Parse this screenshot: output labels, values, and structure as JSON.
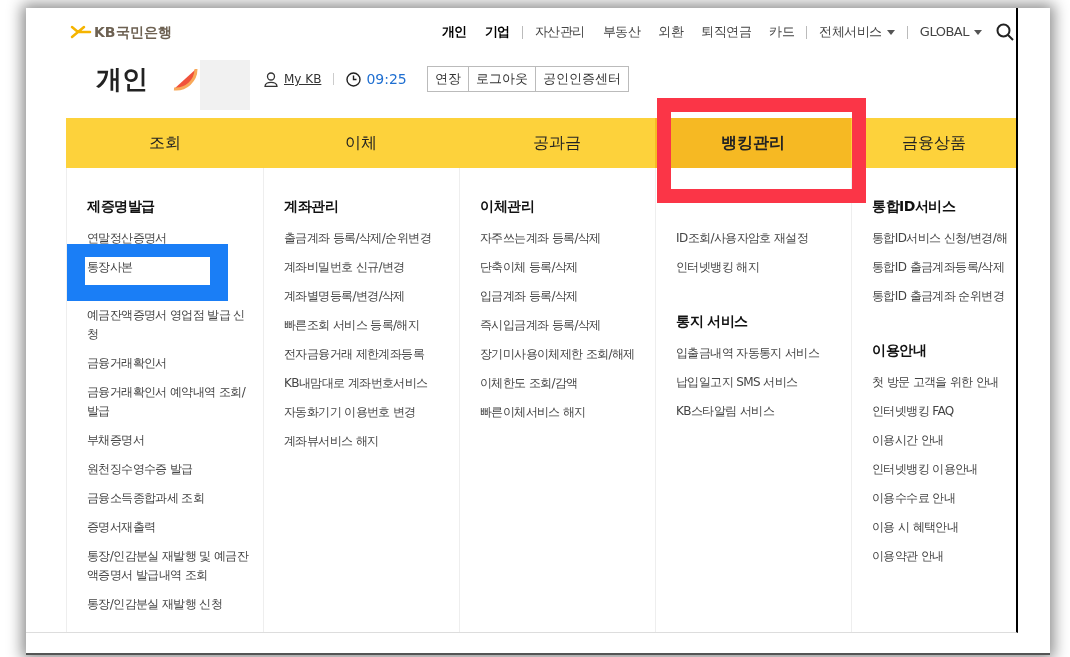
{
  "logo": {
    "text": "KB국민은행"
  },
  "top_nav": [
    {
      "items": [
        {
          "label": "개인",
          "bold": true,
          "has_menu": false
        },
        {
          "label": "기업",
          "bold": true,
          "has_menu": false
        }
      ]
    },
    {
      "items": [
        {
          "label": "자산관리",
          "bold": false,
          "has_menu": false
        },
        {
          "label": "부동산",
          "bold": false,
          "has_menu": false
        },
        {
          "label": "외환",
          "bold": false,
          "has_menu": false
        },
        {
          "label": "퇴직연금",
          "bold": false,
          "has_menu": false
        },
        {
          "label": "카드",
          "bold": false,
          "has_menu": false
        }
      ]
    },
    {
      "items": [
        {
          "label": "전체서비스",
          "bold": false,
          "has_menu": true
        }
      ]
    },
    {
      "items": [
        {
          "label": "GLOBAL",
          "bold": false,
          "has_menu": true
        }
      ]
    }
  ],
  "session": {
    "page_title": "개인",
    "user_link": "My KB",
    "timer": "09:25",
    "buttons": [
      "연장",
      "로그아웃",
      "공인인증센터"
    ]
  },
  "main_nav": [
    {
      "label": "조회",
      "selected": false,
      "annotated": false
    },
    {
      "label": "이체",
      "selected": false,
      "annotated": false
    },
    {
      "label": "공과금",
      "selected": false,
      "annotated": false
    },
    {
      "label": "뱅킹관리",
      "selected": true,
      "annotated": true
    },
    {
      "label": "금융상품",
      "selected": false,
      "annotated": false
    }
  ],
  "menu_columns": [
    {
      "sections": [
        {
          "heading": "제증명발급",
          "items": [
            {
              "label": "연말정산증명서",
              "annotated": false
            },
            {
              "label": "통장사본",
              "annotated": true
            },
            {
              "label": "예금잔액증명서 영업점 발급 신청",
              "annotated": false
            },
            {
              "label": "금융거래확인서",
              "annotated": false
            },
            {
              "label": "금융거래확인서 예약내역 조회/발급",
              "annotated": false
            },
            {
              "label": "부채증명서",
              "annotated": false
            },
            {
              "label": "원천징수영수증 발급",
              "annotated": false
            },
            {
              "label": "금융소득종합과세 조회",
              "annotated": false
            },
            {
              "label": "증명서재출력",
              "annotated": false
            },
            {
              "label": "통장/인감분실 재발행 및 예금잔액증명서 발급내역 조회",
              "annotated": false
            },
            {
              "label": "통장/인감분실 재발행 신청",
              "annotated": false
            }
          ]
        }
      ]
    },
    {
      "sections": [
        {
          "heading": "계좌관리",
          "items": [
            {
              "label": "출금계좌 등록/삭제/순위변경",
              "annotated": false
            },
            {
              "label": "계좌비밀번호 신규/변경",
              "annotated": false
            },
            {
              "label": "계좌별명등록/변경/삭제",
              "annotated": false
            },
            {
              "label": "빠른조회 서비스 등록/해지",
              "annotated": false
            },
            {
              "label": "전자금융거래 제한계좌등록",
              "annotated": false
            },
            {
              "label": "KB내맘대로 계좌번호서비스",
              "annotated": false
            },
            {
              "label": "자동화기기 이용번호 변경",
              "annotated": false
            },
            {
              "label": "계좌뷰서비스 해지",
              "annotated": false
            }
          ]
        }
      ]
    },
    {
      "sections": [
        {
          "heading": "이체관리",
          "items": [
            {
              "label": "자주쓰는계좌 등록/삭제",
              "annotated": false
            },
            {
              "label": "단축이체 등록/삭제",
              "annotated": false
            },
            {
              "label": "입금계좌 등록/삭제",
              "annotated": false
            },
            {
              "label": "즉시입금계좌 등록/삭제",
              "annotated": false
            },
            {
              "label": "장기미사용이체제한 조회/해제",
              "annotated": false
            },
            {
              "label": "이체한도 조회/감액",
              "annotated": false
            },
            {
              "label": "빠른이체서비스 해지",
              "annotated": false
            }
          ]
        }
      ]
    },
    {
      "sections": [
        {
          "items": [
            {
              "label": "ID조회/사용자암호 재설정",
              "annotated": false
            },
            {
              "label": "인터넷뱅킹 해지",
              "annotated": false
            }
          ]
        },
        {
          "heading": "통지 서비스",
          "items": [
            {
              "label": "입출금내역 자동통지 서비스",
              "annotated": false
            },
            {
              "label": "납입일고지 SMS 서비스",
              "annotated": false
            },
            {
              "label": "KB스타알림 서비스",
              "annotated": false
            }
          ]
        }
      ]
    },
    {
      "sections": [
        {
          "heading": "통합ID서비스",
          "items": [
            {
              "label": "통합ID서비스 신청/변경/해",
              "annotated": false
            },
            {
              "label": "통합ID 출금계좌등록/삭제",
              "annotated": false
            },
            {
              "label": "통합ID 출금계좌 순위변경",
              "annotated": false
            }
          ]
        },
        {
          "heading": "이용안내",
          "items": [
            {
              "label": "첫 방문 고객을 위한 안내",
              "annotated": false
            },
            {
              "label": "인터넷뱅킹 FAQ",
              "annotated": false
            },
            {
              "label": "이용시간 안내",
              "annotated": false
            },
            {
              "label": "인터넷뱅킹 이용안내",
              "annotated": false
            },
            {
              "label": "이용수수료 안내",
              "annotated": false
            },
            {
              "label": "이용 시 혜택안내",
              "annotated": false
            },
            {
              "label": "이용약관 안내",
              "annotated": false
            }
          ]
        }
      ]
    }
  ]
}
